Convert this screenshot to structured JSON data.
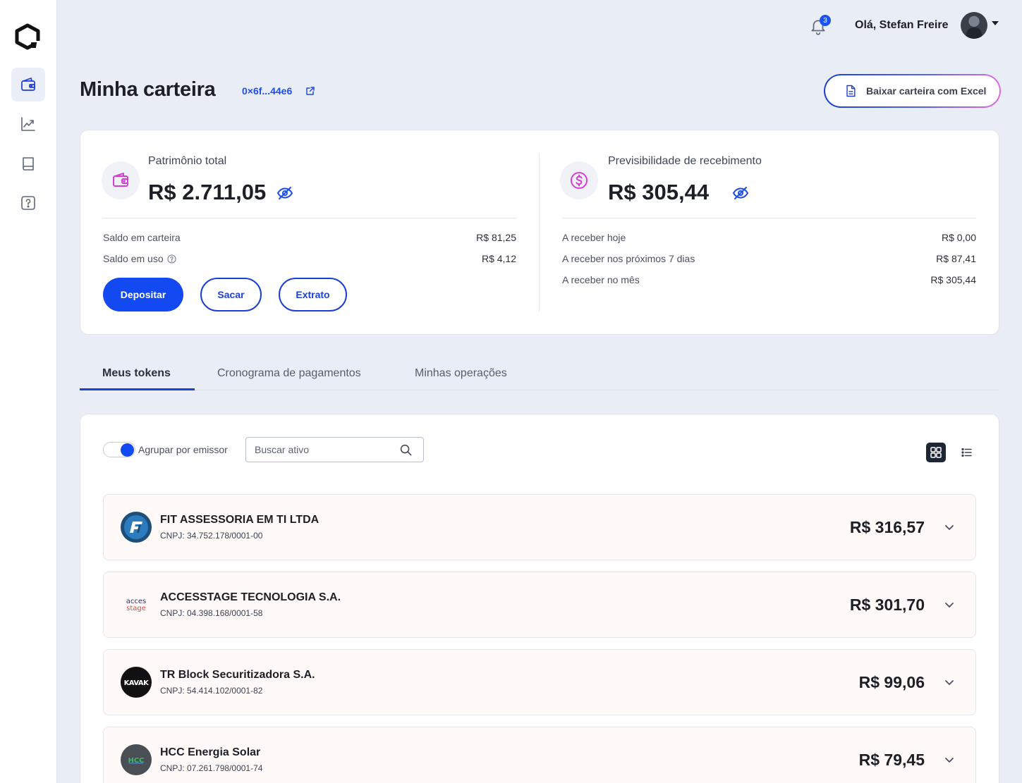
{
  "header": {
    "notification_count": "3",
    "greeting": "Olá, Stefan Freire"
  },
  "sidebar": {
    "items": [
      {
        "name": "wallet",
        "active": true
      },
      {
        "name": "chart"
      },
      {
        "name": "book"
      },
      {
        "name": "help"
      }
    ]
  },
  "page": {
    "title": "Minha carteira",
    "wallet_address": "0×6f...44e6",
    "download_button": "Baixar carteira com Excel"
  },
  "patrimonio": {
    "label": "Patrimônio total",
    "value": "R$ 2.711,05",
    "rows": [
      {
        "label": "Saldo em carteira",
        "value": "R$ 81,25"
      },
      {
        "label": "Saldo em uso",
        "value": "R$ 4,12"
      }
    ],
    "buttons": {
      "deposit": "Depositar",
      "withdraw": "Sacar",
      "statement": "Extrato"
    }
  },
  "previsibilidade": {
    "label": "Previsibilidade de recebimento",
    "value": "R$ 305,44",
    "rows": [
      {
        "label": "A receber hoje",
        "value": "R$ 0,00"
      },
      {
        "label": "A receber nos próximos 7 dias",
        "value": "R$ 87,41"
      },
      {
        "label": "A receber no mês",
        "value": "R$ 305,44"
      }
    ]
  },
  "tabs": [
    {
      "label": "Meus tokens",
      "active": true
    },
    {
      "label": "Cronograma de pagamentos"
    },
    {
      "label": "Minhas operações"
    }
  ],
  "tokens": {
    "group_toggle_label": "Agrupar por emissor",
    "group_toggle_on": true,
    "search_placeholder": "Buscar ativo",
    "view_mode": "grid",
    "issuers": [
      {
        "name": "FIT ASSESSORIA EM TI LTDA",
        "cnpj": "CNPJ: 34.752.178/0001-00",
        "amount": "R$ 316,57",
        "logo_text": "FIT"
      },
      {
        "name": "ACCESSTAGE TECNOLOGIA S.A.",
        "cnpj": "CNPJ: 04.398.168/0001-58",
        "amount": "R$ 301,70",
        "logo_text": "acces stage"
      },
      {
        "name": "TR Block Securitizadora S.A.",
        "cnpj": "CNPJ: 54.414.102/0001-82",
        "amount": "R$ 99,06",
        "logo_text": "KAVAK"
      },
      {
        "name": "HCC Energia Solar",
        "cnpj": "CNPJ: 07.261.798/0001-74",
        "amount": "R$ 79,45",
        "logo_text": "HCC"
      }
    ]
  },
  "colors": {
    "primary": "#1349f0",
    "accent_gradient_end": "#e06be0",
    "icon_pink": "#d63fd6"
  }
}
